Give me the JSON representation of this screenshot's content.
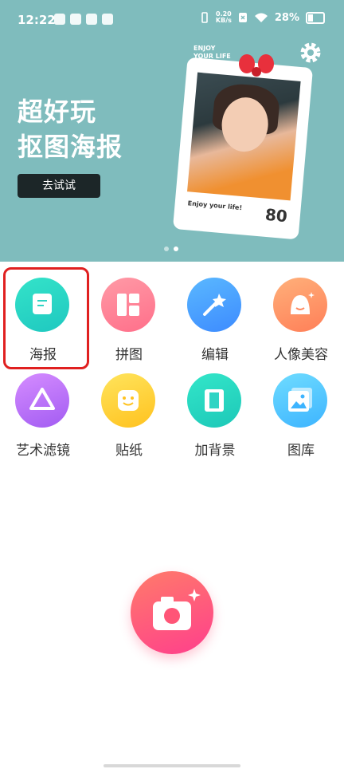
{
  "status_bar": {
    "time": "12:22",
    "net_speed_value": "0.20",
    "net_speed_unit": "KB/s",
    "battery": "28%"
  },
  "banner": {
    "headline_line1": "超好玩",
    "headline_line2": "抠图海报",
    "try_button": "去试试",
    "stamp_top_text_1": "ENJOY",
    "stamp_top_text_2": "YOUR LIFE",
    "stamp_caption": "Enjoy your life!",
    "stamp_number": "80",
    "page_indicator": {
      "count": 2,
      "active": 2
    }
  },
  "features": [
    {
      "label": "海报",
      "icon": "poster-icon",
      "color_from": "#34e3c9",
      "color_to": "#1fc8c0"
    },
    {
      "label": "拼图",
      "icon": "collage-icon",
      "color_from": "#ff9aa6",
      "color_to": "#ff6f8a"
    },
    {
      "label": "编辑",
      "icon": "magic-wand-icon",
      "color_from": "#5ab8ff",
      "color_to": "#3d8bff"
    },
    {
      "label": "人像美容",
      "icon": "portrait-beauty-icon",
      "color_from": "#ffb07a",
      "color_to": "#ff7f58"
    },
    {
      "label": "艺术滤镜",
      "icon": "art-filter-icon",
      "color_from": "#d58cff",
      "color_to": "#a25cf2"
    },
    {
      "label": "贴纸",
      "icon": "sticker-icon",
      "color_from": "#ffe45c",
      "color_to": "#ffc21f"
    },
    {
      "label": "加背景",
      "icon": "add-background-icon",
      "color_from": "#33e6c9",
      "color_to": "#1dc8b8"
    },
    {
      "label": "图库",
      "icon": "gallery-icon",
      "color_from": "#6fdcff",
      "color_to": "#3db4ff"
    }
  ],
  "camera_button": {
    "icon": "camera-icon"
  }
}
